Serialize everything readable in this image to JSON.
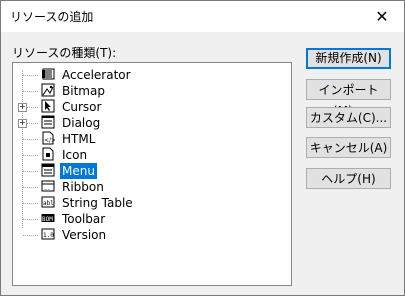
{
  "window": {
    "title": "リソースの追加",
    "close_glyph": "✕"
  },
  "tree": {
    "label_text": "リソースの種類(T):",
    "items": [
      {
        "label": "Accelerator",
        "icon": "accelerator-icon",
        "expandable": false
      },
      {
        "label": "Bitmap",
        "icon": "bitmap-icon",
        "expandable": false
      },
      {
        "label": "Cursor",
        "icon": "cursor-icon",
        "expandable": true
      },
      {
        "label": "Dialog",
        "icon": "dialog-icon",
        "expandable": true
      },
      {
        "label": "HTML",
        "icon": "html-icon",
        "expandable": false
      },
      {
        "label": "Icon",
        "icon": "icon-resource-icon",
        "expandable": false
      },
      {
        "label": "Menu",
        "icon": "menu-icon",
        "expandable": false,
        "selected": true
      },
      {
        "label": "Ribbon",
        "icon": "ribbon-icon",
        "expandable": false
      },
      {
        "label": "String Table",
        "icon": "string-table-icon",
        "expandable": false
      },
      {
        "label": "Toolbar",
        "icon": "toolbar-icon",
        "expandable": false
      },
      {
        "label": "Version",
        "icon": "version-icon",
        "expandable": false
      }
    ],
    "icon_text": {
      "ribbon": "...",
      "string_table": "abl",
      "toolbar": "BOM",
      "version": "1.0"
    },
    "expander_glyph": "+"
  },
  "buttons": {
    "new": "新規作成(N)",
    "import": "インポート(M)...",
    "custom": "カスタム(C)...",
    "cancel": "キャンセル(A)",
    "help": "ヘルプ(H)"
  },
  "colors": {
    "selection": "#0078d7",
    "default_button_border": "#0078d7"
  }
}
